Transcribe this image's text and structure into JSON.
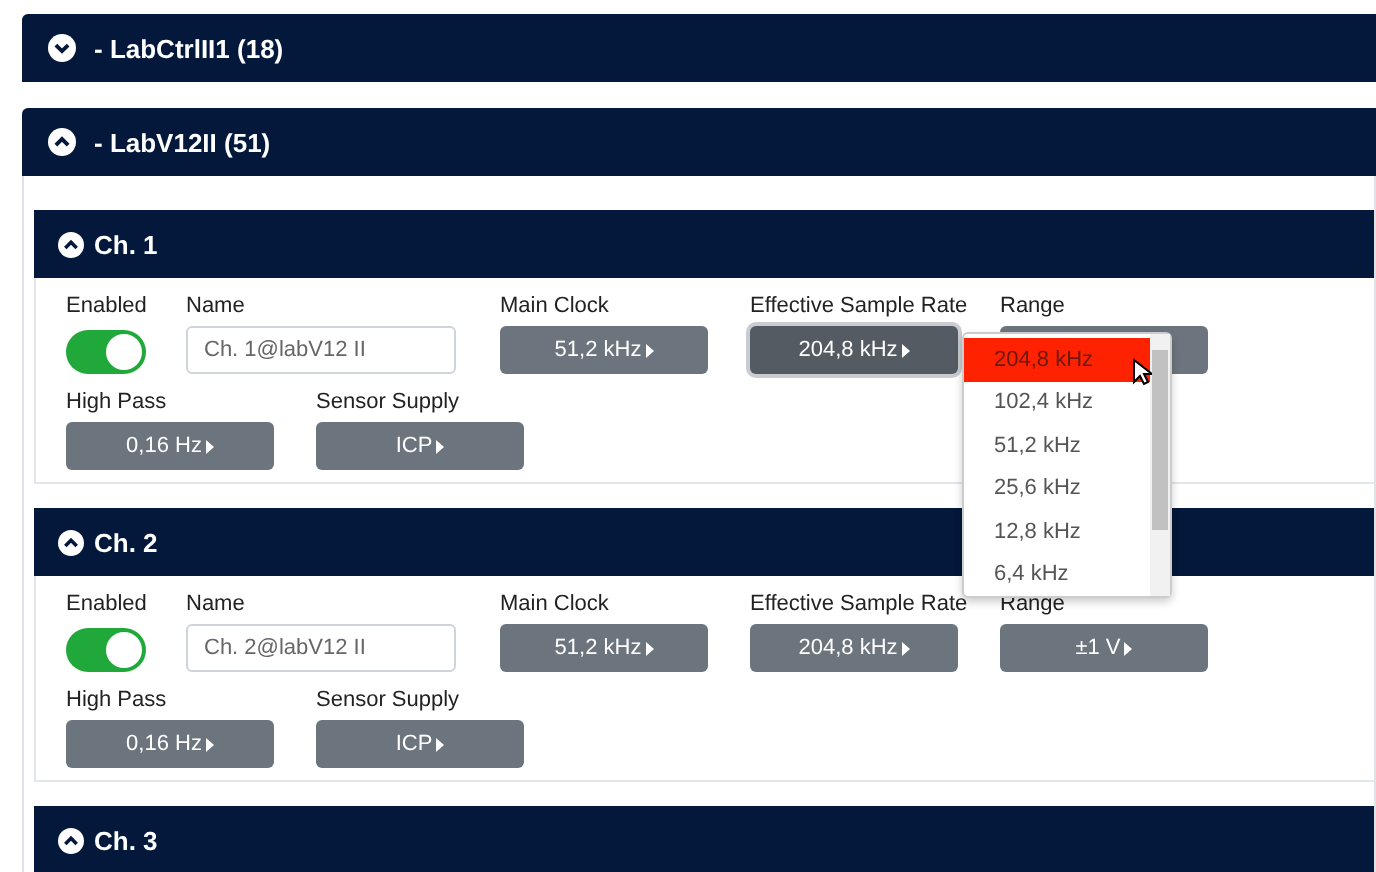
{
  "groups": [
    {
      "title": "- LabCtrlII1 (18)",
      "expanded": false
    },
    {
      "title": "- LabV12II (51)",
      "expanded": true,
      "channels": [
        {
          "title": "Ch. 1",
          "expanded": true,
          "fields": [
            {
              "kind": "toggle",
              "label": "Enabled",
              "on": true
            },
            {
              "kind": "input",
              "label": "Name",
              "value": "Ch. 1@labV12 II"
            },
            {
              "kind": "select",
              "label": "Main Clock",
              "value": "51,2 kHz",
              "open": false
            },
            {
              "kind": "select",
              "label": "Effective Sample Rate",
              "value": "204,8 kHz",
              "open": true,
              "options": [
                {
                  "label": "204,8 kHz",
                  "selected": true
                },
                {
                  "label": "102,4 kHz",
                  "selected": false
                },
                {
                  "label": "51,2 kHz",
                  "selected": false
                },
                {
                  "label": "25,6 kHz",
                  "selected": false
                },
                {
                  "label": "12,8 kHz",
                  "selected": false
                },
                {
                  "label": "6,4 kHz",
                  "selected": false
                }
              ]
            },
            {
              "kind": "select",
              "label": "Range",
              "open": false
            },
            {
              "kind": "select",
              "label": "High Pass",
              "value": "0,16 Hz",
              "open": false
            },
            {
              "kind": "select",
              "label": "Sensor Supply",
              "value": "ICP",
              "open": false
            }
          ]
        },
        {
          "title": "Ch. 2",
          "expanded": true,
          "fields": [
            {
              "kind": "toggle",
              "label": "Enabled",
              "on": true
            },
            {
              "kind": "input",
              "label": "Name",
              "value": "Ch. 2@labV12 II"
            },
            {
              "kind": "select",
              "label": "Main Clock",
              "value": "51,2 kHz",
              "open": false
            },
            {
              "kind": "select",
              "label": "Effective Sample Rate",
              "value": "204,8 kHz",
              "open": false
            },
            {
              "kind": "select",
              "label": "Range",
              "value": "±1 V",
              "open": false
            },
            {
              "kind": "select",
              "label": "High Pass",
              "value": "0,16 Hz",
              "open": false
            },
            {
              "kind": "select",
              "label": "Sensor Supply",
              "value": "ICP",
              "open": false
            }
          ]
        },
        {
          "title": "Ch. 3",
          "expanded": true
        }
      ]
    }
  ]
}
